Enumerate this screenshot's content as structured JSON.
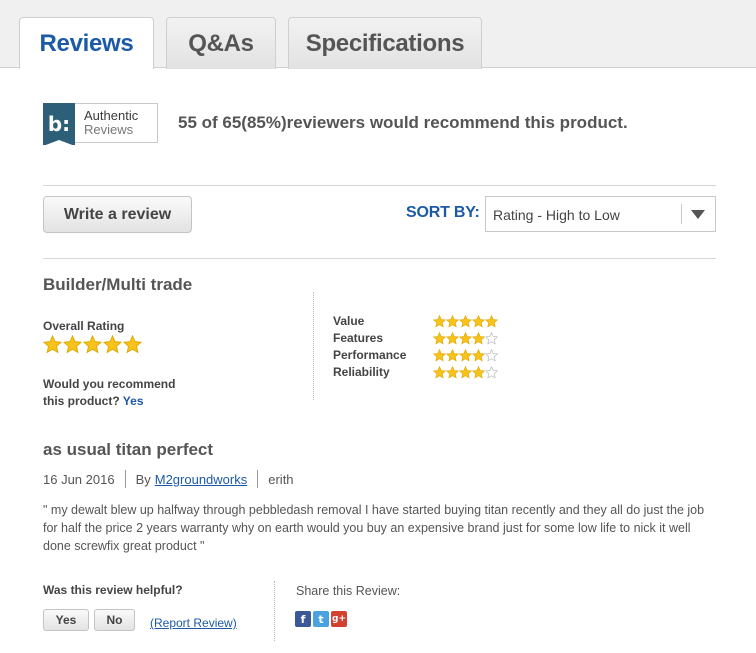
{
  "tabs": [
    {
      "label": "Reviews",
      "active": true
    },
    {
      "label": "Q&As",
      "active": false
    },
    {
      "label": "Specifications",
      "active": false
    }
  ],
  "badge": {
    "mark": "b:",
    "line1": "Authentic",
    "line2": "Reviews"
  },
  "summary": "55 of 65(85%)reviewers would recommend this product.",
  "toolbar": {
    "write_review_label": "Write a review",
    "sort_label": "SORT BY:",
    "sort_value": "Rating - High to Low"
  },
  "review": {
    "reviewer_type": "Builder/Multi trade",
    "overall_label": "Overall Rating",
    "overall_rating": 5,
    "recommend_label_1": "Would you recommend",
    "recommend_label_2": "this product?",
    "recommend_value": "Yes",
    "ratings": [
      {
        "label": "Value",
        "stars": 5
      },
      {
        "label": "Features",
        "stars": 4
      },
      {
        "label": "Performance",
        "stars": 4
      },
      {
        "label": "Reliability",
        "stars": 4
      }
    ],
    "title": "as usual titan perfect",
    "date": "16 Jun 2016",
    "by_label": "By",
    "author": "M2groundworks",
    "location": "erith",
    "body": "\" my dewalt blew up halfway through pebbledash removal I have started buying titan recently and they all do just the job for half the price 2 years warranty why on earth would you buy an expensive brand just for some low life to nick it well done screwfix great product \"",
    "helpful_label": "Was this review helpful?",
    "yes_label": "Yes",
    "no_label": "No",
    "report_label": "(Report Review)",
    "share_label": "Share this Review:"
  },
  "share_icons": [
    {
      "name": "facebook-icon",
      "glyph": "f"
    },
    {
      "name": "twitter-icon",
      "glyph": "t"
    },
    {
      "name": "google-plus-icon",
      "glyph": "g+"
    }
  ],
  "colors": {
    "accent": "#1c5aa8",
    "star": "#f7c31a",
    "star_empty": "#cccccc",
    "badge": "#2e5f78"
  }
}
